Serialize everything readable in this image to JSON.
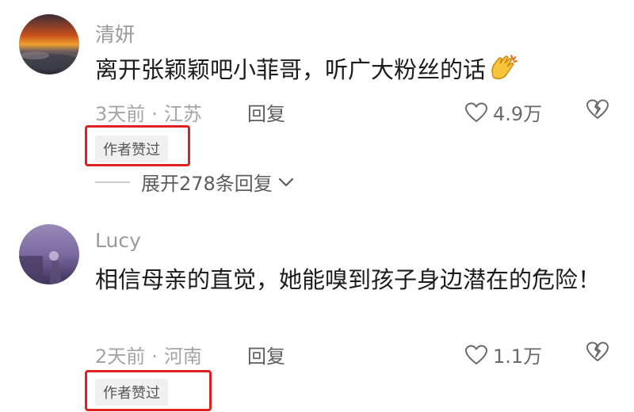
{
  "comments": [
    {
      "username": "清妍",
      "text": "离开张颖颖吧小菲哥，听广大粉丝的话",
      "emoji": "clapping-hands-emoji",
      "time": "3天前",
      "location": "江苏",
      "reply_label": "回复",
      "likes": "4.9万",
      "badge": "作者赞过",
      "expand_label": "展开278条回复"
    },
    {
      "username": "Lucy",
      "text": "相信母亲的直觉，她能嗅到孩子身边潜在的危险！",
      "time": "2天前",
      "location": "河南",
      "reply_label": "回复",
      "likes": "1.1万",
      "badge": "作者赞过"
    }
  ],
  "colors": {
    "highlight": "#e02020",
    "username": "#9a9a9a",
    "meta": "#a4a4a4",
    "text": "#1c1c1c"
  }
}
